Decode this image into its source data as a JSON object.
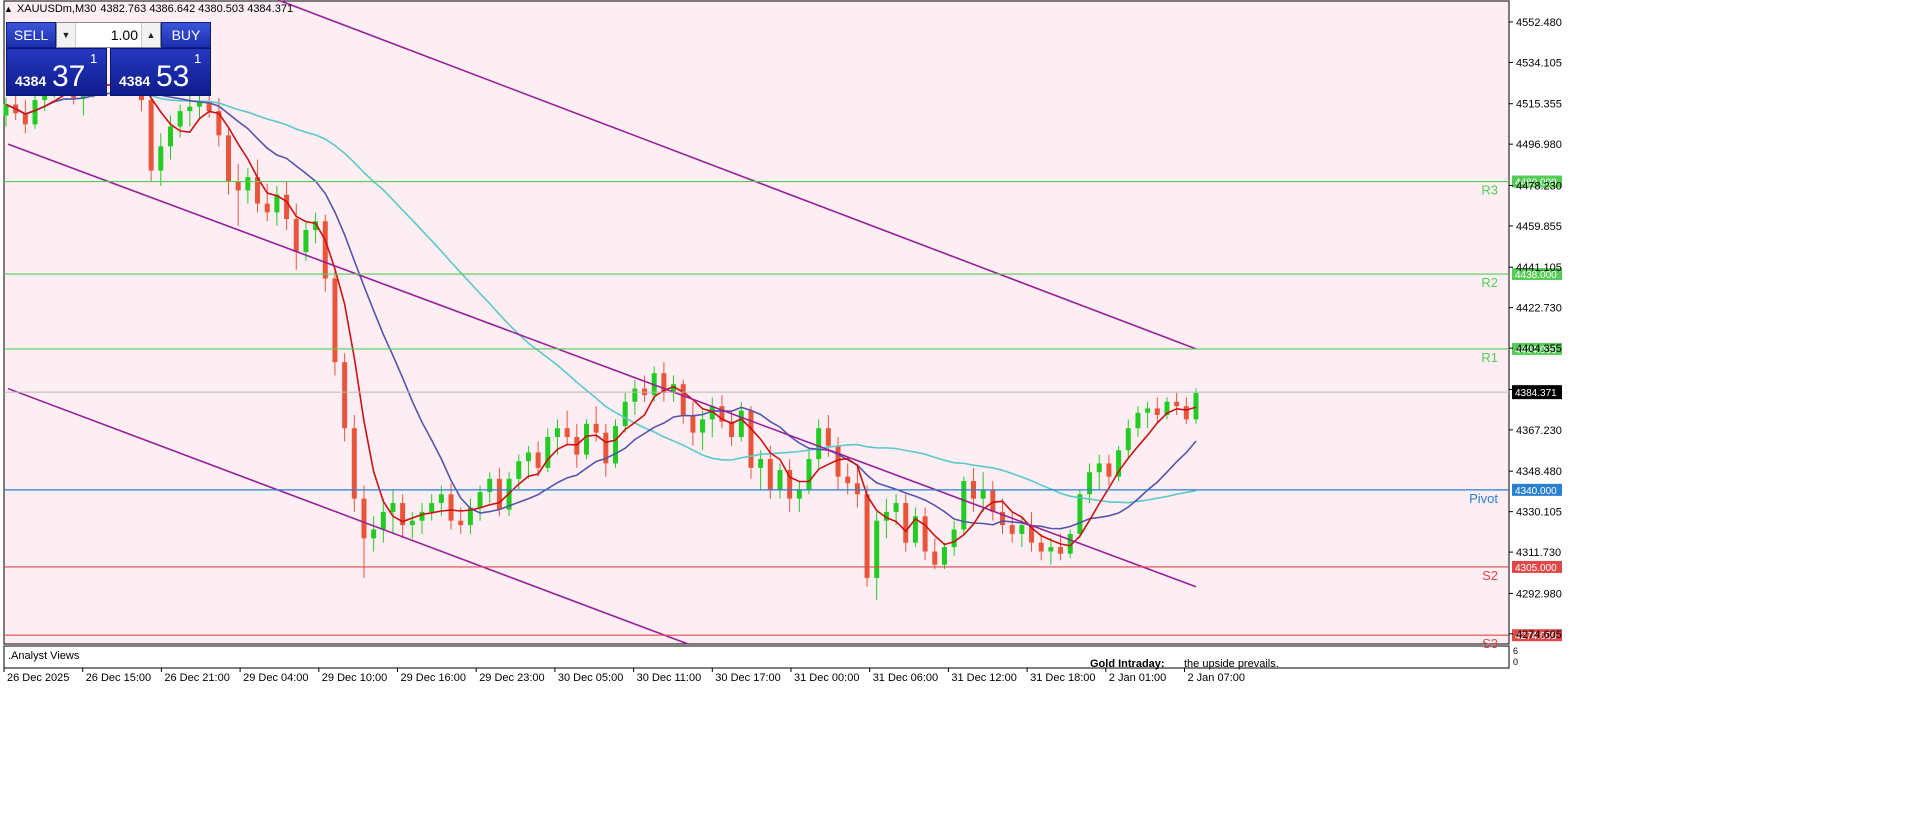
{
  "header": {
    "symbol": "XAUUSDm,M30",
    "ohlc": "4382.763 4386.642 4380.503 4384.371"
  },
  "trade_panel": {
    "sell_label": "SELL",
    "buy_label": "BUY",
    "lot": "1.00",
    "sell_small": "4384",
    "sell_big": "37",
    "sell_sup": "1",
    "buy_small": "4384",
    "buy_big": "53",
    "buy_sup": "1"
  },
  "colors": {
    "background": "#fdeef4",
    "bull": "#22cc22",
    "bear": "#e8553a",
    "ma_fast": "#cc1111",
    "ma_mid": "#5555aa",
    "ma_slow": "#5cc8c8",
    "channel": "#9a1f9a",
    "resistance": "#55cc55",
    "pivot": "#2a7fd0",
    "support": "#e04848"
  },
  "price_axis": {
    "ticks": [
      "4552.480",
      "4534.105",
      "4515.355",
      "4496.980",
      "4478.230",
      "4459.855",
      "4441.105",
      "4422.730",
      "4404.355",
      "4385.605",
      "4367.230",
      "4348.480",
      "4330.105",
      "4311.730",
      "4292.980",
      "4274.605"
    ],
    "tick_values": [
      4552.48,
      4534.105,
      4515.355,
      4496.98,
      4478.23,
      4459.855,
      4441.105,
      4422.73,
      4404.355,
      4385.605,
      4367.23,
      4348.48,
      4330.105,
      4311.73,
      4292.98,
      4274.605
    ],
    "current_price": "4384.371",
    "current_value": 4384.371,
    "indicator_max": "6",
    "indicator_min": "0"
  },
  "levels": [
    {
      "name": "R3",
      "value": 4480.0,
      "label": "4480.000",
      "kind": "resistance"
    },
    {
      "name": "R2",
      "value": 4438.0,
      "label": "4438.000",
      "kind": "resistance"
    },
    {
      "name": "R1",
      "value": 4404.0,
      "label": "4404.000",
      "kind": "resistance"
    },
    {
      "name": "Pivot",
      "value": 4340.0,
      "label": "4340.000",
      "kind": "pivot"
    },
    {
      "name": "S2",
      "value": 4305.0,
      "label": "4305.000",
      "kind": "support"
    },
    {
      "name": "S3",
      "value": 4274.0,
      "label": "4274.000",
      "kind": "support"
    }
  ],
  "time_axis": [
    "26 Dec 2025",
    "26 Dec 15:00",
    "26 Dec 21:00",
    "29 Dec 04:00",
    "29 Dec 10:00",
    "29 Dec 16:00",
    "29 Dec 23:00",
    "30 Dec 05:00",
    "30 Dec 11:00",
    "30 Dec 17:00",
    "31 Dec 00:00",
    "31 Dec 06:00",
    "31 Dec 12:00",
    "31 Dec 18:00",
    "2 Jan 01:00",
    "2 Jan 07:00"
  ],
  "indicator_window": {
    "label": ".Analyst Views",
    "title": "Gold Intraday:",
    "text": "the upside prevails."
  },
  "chart_data": {
    "type": "candlestick",
    "symbol": "XAUUSDm",
    "timeframe": "M30",
    "candles": [
      [
        4510,
        4518,
        4505,
        4515
      ],
      [
        4515,
        4522,
        4508,
        4511
      ],
      [
        4511,
        4517,
        4502,
        4506
      ],
      [
        4506,
        4520,
        4504,
        4517
      ],
      [
        4517,
        4526,
        4512,
        4522
      ],
      [
        4522,
        4530,
        4518,
        4527
      ],
      [
        4527,
        4533,
        4520,
        4524
      ],
      [
        4524,
        4528,
        4515,
        4518
      ],
      [
        4518,
        4525,
        4510,
        4521
      ],
      [
        4521,
        4532,
        4518,
        4529
      ],
      [
        4529,
        4535,
        4522,
        4525
      ],
      [
        4525,
        4531,
        4519,
        4528
      ],
      [
        4528,
        4536,
        4524,
        4533
      ],
      [
        4533,
        4538,
        4524,
        4527
      ],
      [
        4527,
        4530,
        4512,
        4517
      ],
      [
        4517,
        4520,
        4480,
        4485
      ],
      [
        4485,
        4502,
        4478,
        4496
      ],
      [
        4496,
        4510,
        4490,
        4505
      ],
      [
        4505,
        4515,
        4500,
        4512
      ],
      [
        4512,
        4519,
        4505,
        4514
      ],
      [
        4514,
        4520,
        4508,
        4516
      ],
      [
        4516,
        4522,
        4509,
        4512
      ],
      [
        4512,
        4518,
        4496,
        4501
      ],
      [
        4501,
        4505,
        4474,
        4480
      ],
      [
        4480,
        4488,
        4460,
        4476
      ],
      [
        4476,
        4486,
        4470,
        4482
      ],
      [
        4482,
        4490,
        4466,
        4470
      ],
      [
        4470,
        4479,
        4462,
        4466
      ],
      [
        4466,
        4478,
        4460,
        4474
      ],
      [
        4474,
        4480,
        4458,
        4463
      ],
      [
        4463,
        4470,
        4440,
        4448
      ],
      [
        4448,
        4462,
        4444,
        4458
      ],
      [
        4458,
        4466,
        4452,
        4462
      ],
      [
        4462,
        4465,
        4430,
        4436
      ],
      [
        4436,
        4440,
        4392,
        4398
      ],
      [
        4398,
        4402,
        4362,
        4368
      ],
      [
        4368,
        4374,
        4330,
        4336
      ],
      [
        4336,
        4342,
        4300,
        4318
      ],
      [
        4318,
        4328,
        4312,
        4322
      ],
      [
        4322,
        4336,
        4316,
        4330
      ],
      [
        4330,
        4340,
        4320,
        4334
      ],
      [
        4334,
        4338,
        4318,
        4324
      ],
      [
        4324,
        4330,
        4318,
        4326
      ],
      [
        4326,
        4334,
        4320,
        4330
      ],
      [
        4330,
        4338,
        4326,
        4334
      ],
      [
        4334,
        4342,
        4328,
        4338
      ],
      [
        4338,
        4343,
        4322,
        4326
      ],
      [
        4326,
        4332,
        4320,
        4324
      ],
      [
        4324,
        4336,
        4320,
        4332
      ],
      [
        4332,
        4342,
        4326,
        4339
      ],
      [
        4339,
        4348,
        4334,
        4345
      ],
      [
        4345,
        4350,
        4328,
        4331
      ],
      [
        4331,
        4348,
        4328,
        4345
      ],
      [
        4345,
        4356,
        4340,
        4353
      ],
      [
        4353,
        4360,
        4345,
        4357
      ],
      [
        4357,
        4362,
        4346,
        4350
      ],
      [
        4350,
        4368,
        4348,
        4364
      ],
      [
        4364,
        4372,
        4356,
        4368
      ],
      [
        4368,
        4376,
        4360,
        4364
      ],
      [
        4364,
        4370,
        4350,
        4356
      ],
      [
        4356,
        4372,
        4354,
        4370
      ],
      [
        4370,
        4378,
        4362,
        4366
      ],
      [
        4366,
        4370,
        4346,
        4352
      ],
      [
        4352,
        4372,
        4350,
        4369
      ],
      [
        4369,
        4384,
        4366,
        4380
      ],
      [
        4380,
        4390,
        4374,
        4386
      ],
      [
        4386,
        4392,
        4380,
        4383
      ],
      [
        4383,
        4396,
        4380,
        4393
      ],
      [
        4393,
        4398,
        4380,
        4384
      ],
      [
        4384,
        4392,
        4380,
        4388
      ],
      [
        4388,
        4390,
        4370,
        4374
      ],
      [
        4374,
        4380,
        4360,
        4366
      ],
      [
        4366,
        4376,
        4358,
        4372
      ],
      [
        4372,
        4382,
        4364,
        4378
      ],
      [
        4378,
        4383,
        4368,
        4371
      ],
      [
        4371,
        4376,
        4360,
        4364
      ],
      [
        4364,
        4380,
        4362,
        4376
      ],
      [
        4376,
        4378,
        4345,
        4350
      ],
      [
        4350,
        4358,
        4340,
        4354
      ],
      [
        4354,
        4360,
        4336,
        4340
      ],
      [
        4340,
        4352,
        4336,
        4349
      ],
      [
        4349,
        4354,
        4330,
        4336
      ],
      [
        4336,
        4344,
        4330,
        4340
      ],
      [
        4340,
        4358,
        4338,
        4354
      ],
      [
        4354,
        4372,
        4350,
        4368
      ],
      [
        4368,
        4374,
        4355,
        4360
      ],
      [
        4360,
        4364,
        4340,
        4346
      ],
      [
        4346,
        4352,
        4338,
        4343
      ],
      [
        4343,
        4350,
        4332,
        4338
      ],
      [
        4338,
        4342,
        4296,
        4300
      ],
      [
        4300,
        4330,
        4290,
        4326
      ],
      [
        4326,
        4336,
        4318,
        4330
      ],
      [
        4330,
        4338,
        4324,
        4334
      ],
      [
        4334,
        4338,
        4312,
        4316
      ],
      [
        4316,
        4332,
        4314,
        4328
      ],
      [
        4328,
        4332,
        4308,
        4312
      ],
      [
        4312,
        4318,
        4304,
        4306
      ],
      [
        4306,
        4316,
        4304,
        4314
      ],
      [
        4314,
        4326,
        4310,
        4322
      ],
      [
        4322,
        4346,
        4320,
        4344
      ],
      [
        4344,
        4350,
        4330,
        4336
      ],
      [
        4336,
        4348,
        4330,
        4340
      ],
      [
        4340,
        4344,
        4326,
        4330
      ],
      [
        4330,
        4336,
        4320,
        4324
      ],
      [
        4324,
        4330,
        4316,
        4320
      ],
      [
        4320,
        4328,
        4314,
        4324
      ],
      [
        4324,
        4330,
        4312,
        4316
      ],
      [
        4316,
        4320,
        4308,
        4312
      ],
      [
        4312,
        4318,
        4306,
        4314
      ],
      [
        4314,
        4320,
        4308,
        4311
      ],
      [
        4311,
        4322,
        4309,
        4320
      ],
      [
        4320,
        4340,
        4318,
        4338
      ],
      [
        4338,
        4352,
        4334,
        4348
      ],
      [
        4348,
        4356,
        4340,
        4352
      ],
      [
        4352,
        4356,
        4342,
        4346
      ],
      [
        4346,
        4360,
        4344,
        4358
      ],
      [
        4358,
        4372,
        4354,
        4368
      ],
      [
        4368,
        4378,
        4364,
        4375
      ],
      [
        4375,
        4380,
        4368,
        4377
      ],
      [
        4377,
        4382,
        4370,
        4374
      ],
      [
        4374,
        4382,
        4372,
        4380
      ],
      [
        4380,
        4384,
        4374,
        4378
      ],
      [
        4378,
        4382,
        4370,
        4372
      ],
      [
        4372,
        4386,
        4370,
        4384
      ]
    ]
  }
}
